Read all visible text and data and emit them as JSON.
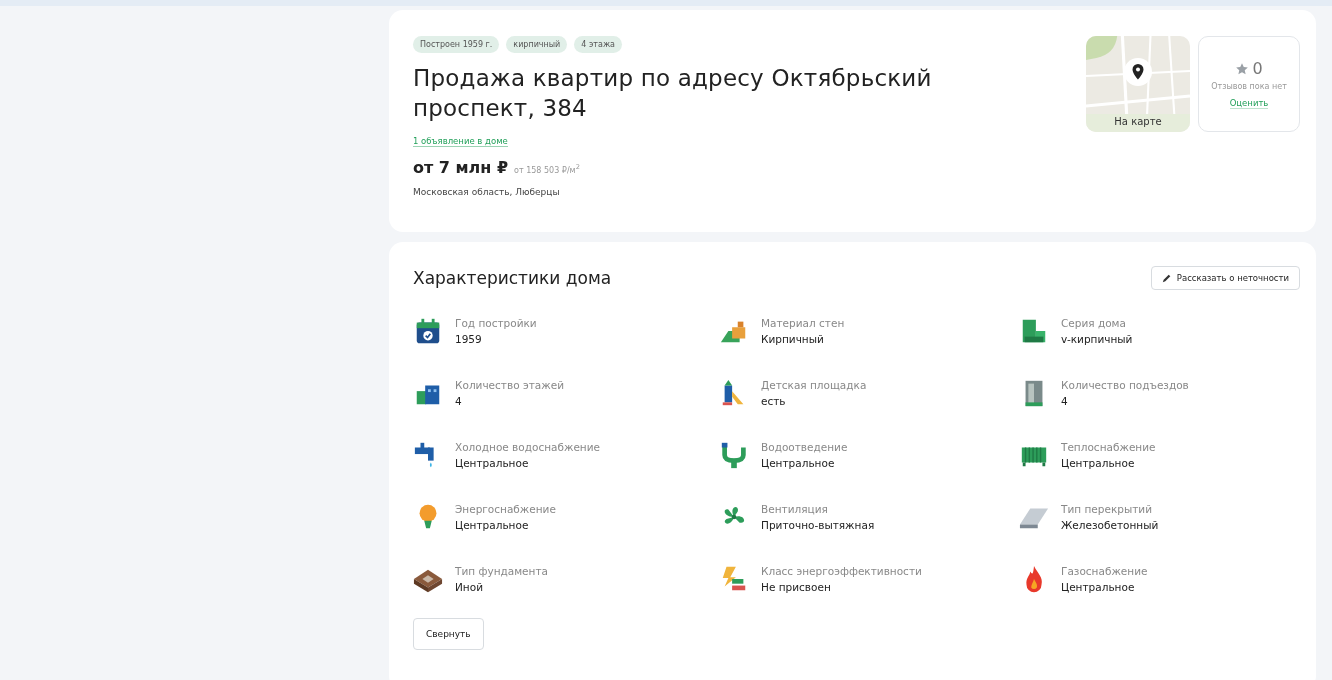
{
  "header": {
    "tags": [
      "Построен 1959 г.",
      "кирпичный",
      "4 этажа"
    ],
    "title": "Продажа квартир по адресу Октябрьский проспект, 384",
    "listings_link": "1 объявление в доме",
    "price": "от 7 млн ₽",
    "price_per_m2": "от 158 503 ₽/м$^{2}$",
    "location": "Московская область, Люберцы",
    "map": {
      "kind": "picture",
      "label": "На карте"
    },
    "reviews": {
      "count": "0",
      "note": "Отзывов пока нет",
      "link": "Оценить"
    }
  },
  "characteristics": {
    "title": "Характеристики дома",
    "report_button": "Рассказать о неточности",
    "items": [
      {
        "label": "Год постройки",
        "value": "1959"
      },
      {
        "label": "Материал стен",
        "value": "Кирпичный"
      },
      {
        "label": "Серия дома",
        "value": "v-кирпичный"
      },
      {
        "label": "Количество этажей",
        "value": "4"
      },
      {
        "label": "Детская площадка",
        "value": "есть"
      },
      {
        "label": "Количество подъездов",
        "value": "4"
      },
      {
        "label": "Холодное водоснабжение",
        "value": "Центральное"
      },
      {
        "label": "Водоотведение",
        "value": "Центральное"
      },
      {
        "label": "Теплоснабжение",
        "value": "Центральное"
      },
      {
        "label": "Энергоснабжение",
        "value": "Центральное"
      },
      {
        "label": "Вентиляция",
        "value": "Приточно-вытяжная"
      },
      {
        "label": "Тип перекрытий",
        "value": "Железобетонный"
      },
      {
        "label": "Тип фундамента",
        "value": "Иной"
      },
      {
        "label": "Класс энергоэффективности",
        "value": "Не присвоен"
      },
      {
        "label": "Газоснабжение",
        "value": "Центральное"
      }
    ],
    "collapse_button": "Свернуть"
  }
}
